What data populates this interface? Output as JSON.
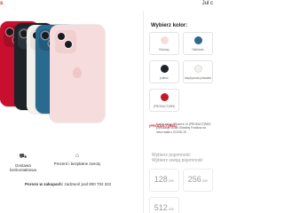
{
  "header": {
    "brand_fragment": "s",
    "right_fragment": "Jul c"
  },
  "features": [
    {
      "icon": "truck-icon",
      "glyph": "⛟",
      "line1": "Dostawa bezkontaktowa",
      "line2": ""
    },
    {
      "icon": "gift-icon",
      "glyph": "⌂",
      "line1": "Prezent i bezpłatne zwroty",
      "line2": ""
    }
  ],
  "pickup": {
    "bold": "Porozo w zakupach:",
    "rest": " zadzwoń pod 800 702 322"
  },
  "color_picker": {
    "title": "Wybierz kolor:",
    "options": [
      {
        "label": "Różowy",
        "color": "#f6dcdc"
      },
      {
        "label": "Niebieski",
        "color": "#2a6a8f"
      },
      {
        "label": "północ",
        "color": "#1e2329"
      },
      {
        "label": "księżycowa poświata",
        "color": "#f3f1ec"
      },
      {
        "label": "(PRODUCT)RED",
        "color": "#c21a2b"
      }
    ]
  },
  "product_red": {
    "logo": "(PRODUCT)RED",
    "text": "Każdy zakup iPhone'a 13 (PRODUCT)RED przekazuje środki Globalny Fundusz na rzecz walki z COVID-19."
  },
  "storage": {
    "title_line1": "Wybierz pojemność",
    "title_line2": "Wybierz swoją pojemność",
    "options": [
      {
        "value": "128",
        "unit": "GB*"
      },
      {
        "value": "256",
        "unit": "GB*"
      },
      {
        "value": "512",
        "unit": "GB*"
      }
    ]
  },
  "phones_render": {
    "colors": [
      "#c8102e",
      "#1e2329",
      "#f3f1ec",
      "#2a6a8f",
      "#f6dcdc"
    ]
  }
}
